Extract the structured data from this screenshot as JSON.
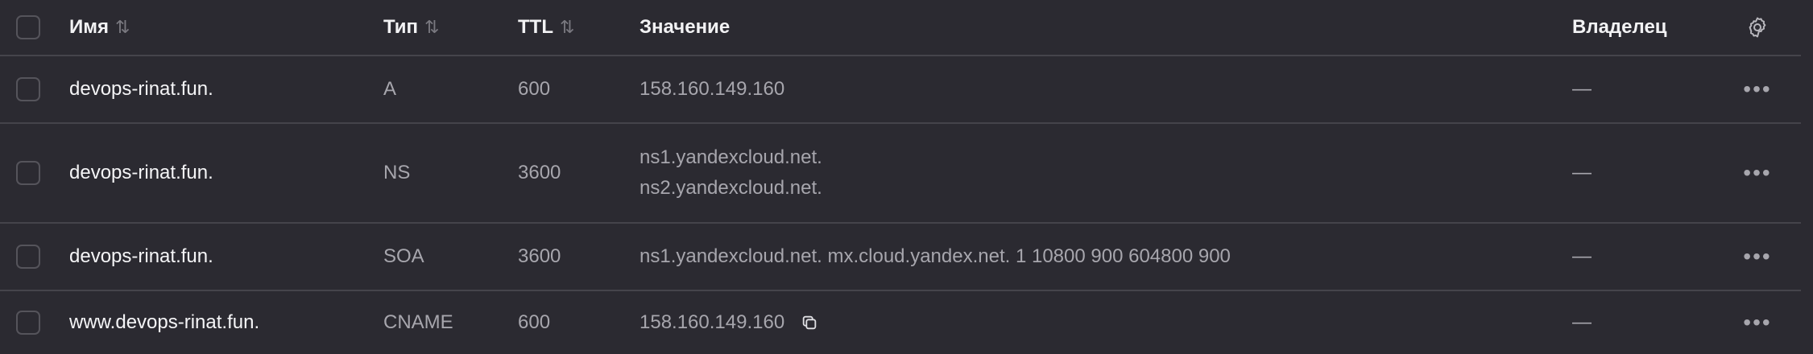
{
  "header": {
    "name_label": "Имя",
    "type_label": "Тип",
    "ttl_label": "TTL",
    "value_label": "Значение",
    "owner_label": "Владелец",
    "sort_icon": "sort-icon",
    "settings_icon": "gear-icon"
  },
  "records": [
    {
      "name": "devops-rinat.fun.",
      "type": "A",
      "ttl": "600",
      "values": [
        "158.160.149.160"
      ],
      "owner": "—"
    },
    {
      "name": "devops-rinat.fun.",
      "type": "NS",
      "ttl": "3600",
      "values": [
        "ns1.yandexcloud.net.",
        "ns2.yandexcloud.net."
      ],
      "owner": "—"
    },
    {
      "name": "devops-rinat.fun.",
      "type": "SOA",
      "ttl": "3600",
      "values": [
        "ns1.yandexcloud.net. mx.cloud.yandex.net. 1 10800 900 604800 900"
      ],
      "owner": "—"
    },
    {
      "name": "www.devops-rinat.fun.",
      "type": "CNAME",
      "ttl": "600",
      "values": [
        "158.160.149.160"
      ],
      "owner": "—"
    }
  ],
  "actions_glyph": "•••",
  "colors": {
    "background": "#2b2a31",
    "divider": "#45444b",
    "text_primary": "#f5f5f7",
    "text_muted": "#a7a6ad"
  }
}
